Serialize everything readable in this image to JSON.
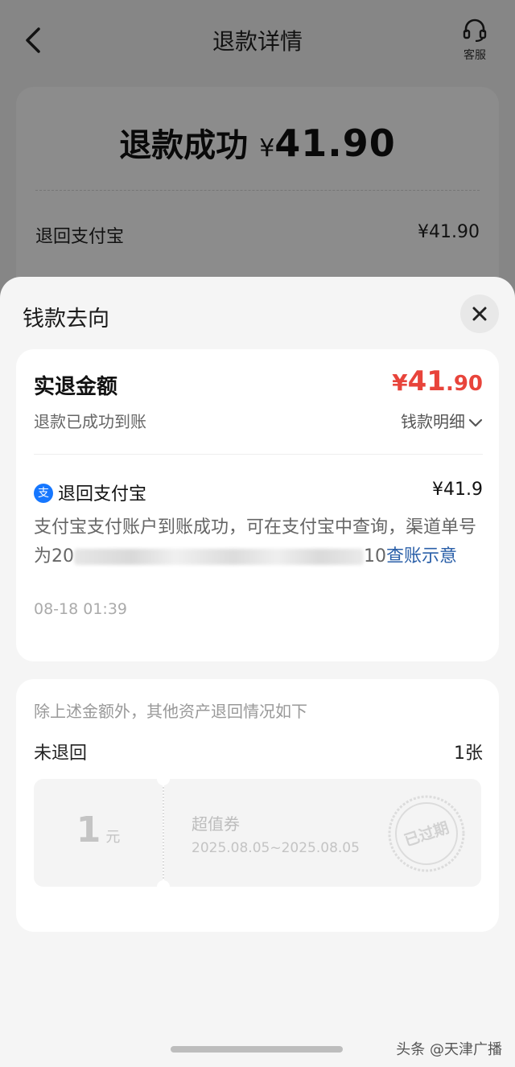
{
  "nav": {
    "title": "退款详情",
    "service_label": "客服"
  },
  "summary": {
    "status": "退款成功",
    "currency": "¥",
    "amount": "41.90",
    "row_label": "退回支付宝",
    "row_value": "¥41.90"
  },
  "sheet": {
    "title": "钱款去向",
    "card1": {
      "title": "实退金额",
      "amount_currency": "¥",
      "amount_int": "41",
      "amount_dec": ".90",
      "subtitle": "退款已成功到账",
      "detail_link": "钱款明细",
      "method_icon": "支",
      "method_label": "退回支付宝",
      "method_amount": "¥41.9",
      "desc_prefix": "支付宝支付账户到账成功，可在支付宝中查询，渠道单号为",
      "desc_masked_head": "20",
      "desc_masked_tail": "10",
      "desc_link": "查账示意",
      "time": "08-18 01:39"
    },
    "card2": {
      "note": "除上述金额外，其他资产退回情况如下",
      "label": "未退回",
      "count": "1张",
      "coupon": {
        "value": "1",
        "unit": "元",
        "name": "超值券",
        "validity": "2025.08.05~2025.08.05",
        "stamp": "已过期"
      }
    }
  },
  "watermark": "头条 @天津广播",
  "colors": {
    "accent_red": "#e8443b",
    "link_blue": "#2a5fa8",
    "alipay_blue": "#1677ff"
  }
}
